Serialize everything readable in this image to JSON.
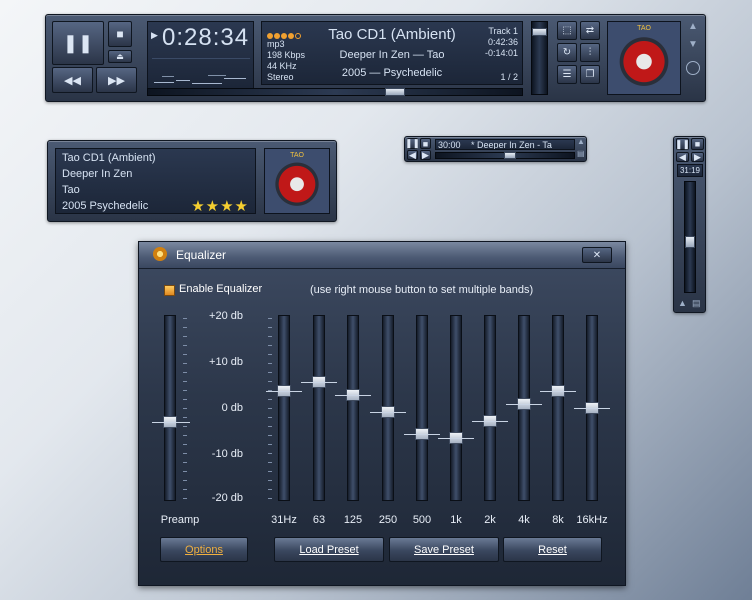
{
  "main_player": {
    "time": "0:28:34",
    "stars_indicator_count": 5,
    "format": "mp3",
    "bitrate": "198 Kbps",
    "samplerate": "44 KHz",
    "channels": "Stereo",
    "title": "Tao CD1 (Ambient)",
    "artist_line": "Deeper In Zen — Tao",
    "year_genre": "2005 — Psychedelic",
    "track_label": "Track 1",
    "track_length": "0:42:36",
    "remaining": "-0:14:01",
    "page": "1 / 2",
    "seek_fraction": 0.67,
    "volume_fraction": 0.9,
    "art_caption": "TAO"
  },
  "info_panel": {
    "line1": "Tao CD1 (Ambient)",
    "line2": "Deeper In Zen",
    "line3": "Tao",
    "line4": "2005  Psychedelic",
    "rating": "★★★★",
    "art_caption": "TAO"
  },
  "mini_player": {
    "time": "30:00",
    "title": "* Deeper In Zen - Ta",
    "seek_fraction": 0.54
  },
  "vertical_player": {
    "time": "31:19",
    "position_fraction": 0.55
  },
  "equalizer": {
    "title": "Equalizer",
    "close": "✕",
    "enable_label": "Enable Equalizer",
    "hint": "(use right mouse button to set multiple bands)",
    "db_labels": [
      "+20 db",
      "+10 db",
      "0 db",
      "-10 db",
      "-20 db"
    ],
    "preamp_label": "Preamp",
    "preamp_value_db": 0,
    "bands": [
      {
        "label": "31Hz",
        "value_db": 4
      },
      {
        "label": "63",
        "value_db": 6
      },
      {
        "label": "125",
        "value_db": 3
      },
      {
        "label": "250",
        "value_db": -1
      },
      {
        "label": "500",
        "value_db": -6
      },
      {
        "label": "1k",
        "value_db": -7
      },
      {
        "label": "2k",
        "value_db": -3
      },
      {
        "label": "4k",
        "value_db": 1
      },
      {
        "label": "8k",
        "value_db": 4
      },
      {
        "label": "16kHz",
        "value_db": 0
      }
    ],
    "buttons": {
      "options": "Options",
      "load": "Load Preset",
      "save": "Save Preset",
      "reset": "Reset"
    },
    "colors": {
      "checkbox": "#f0a030",
      "options_text": "#f0b040"
    }
  }
}
